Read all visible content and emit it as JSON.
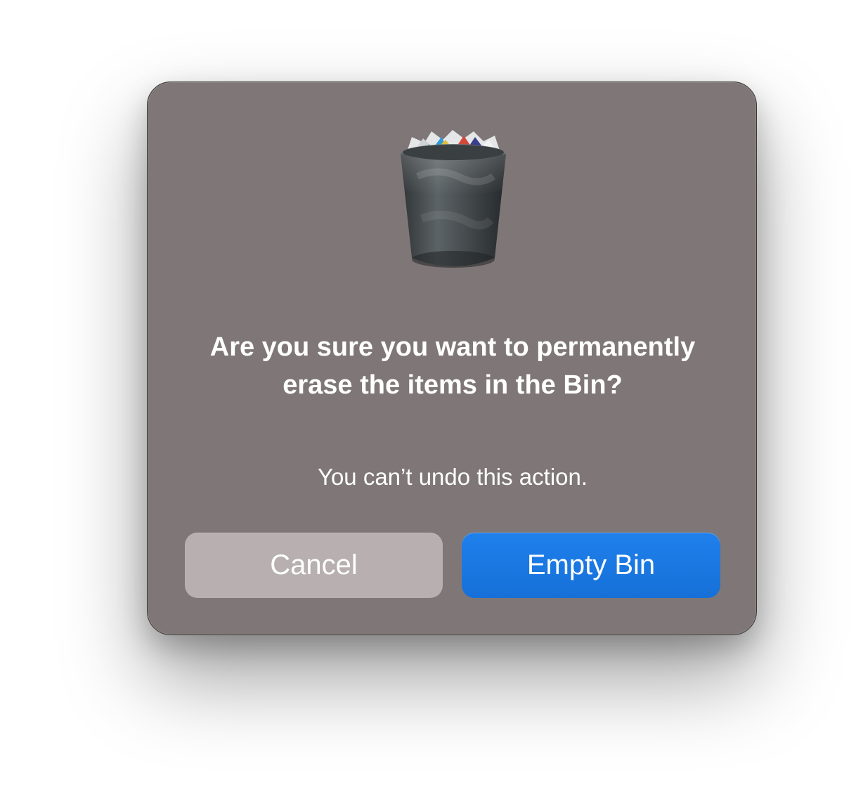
{
  "dialog": {
    "icon": "trash-bin-full-icon",
    "title": "Are you sure you want to permanently erase the items in the Bin?",
    "message": "You can’t undo this action.",
    "cancel_label": "Cancel",
    "confirm_label": "Empty Bin"
  },
  "colors": {
    "dialog_background": "#7f7777",
    "cancel_button": "#b8b0b0",
    "primary_button": "#1a76e2",
    "text": "#ffffff"
  }
}
